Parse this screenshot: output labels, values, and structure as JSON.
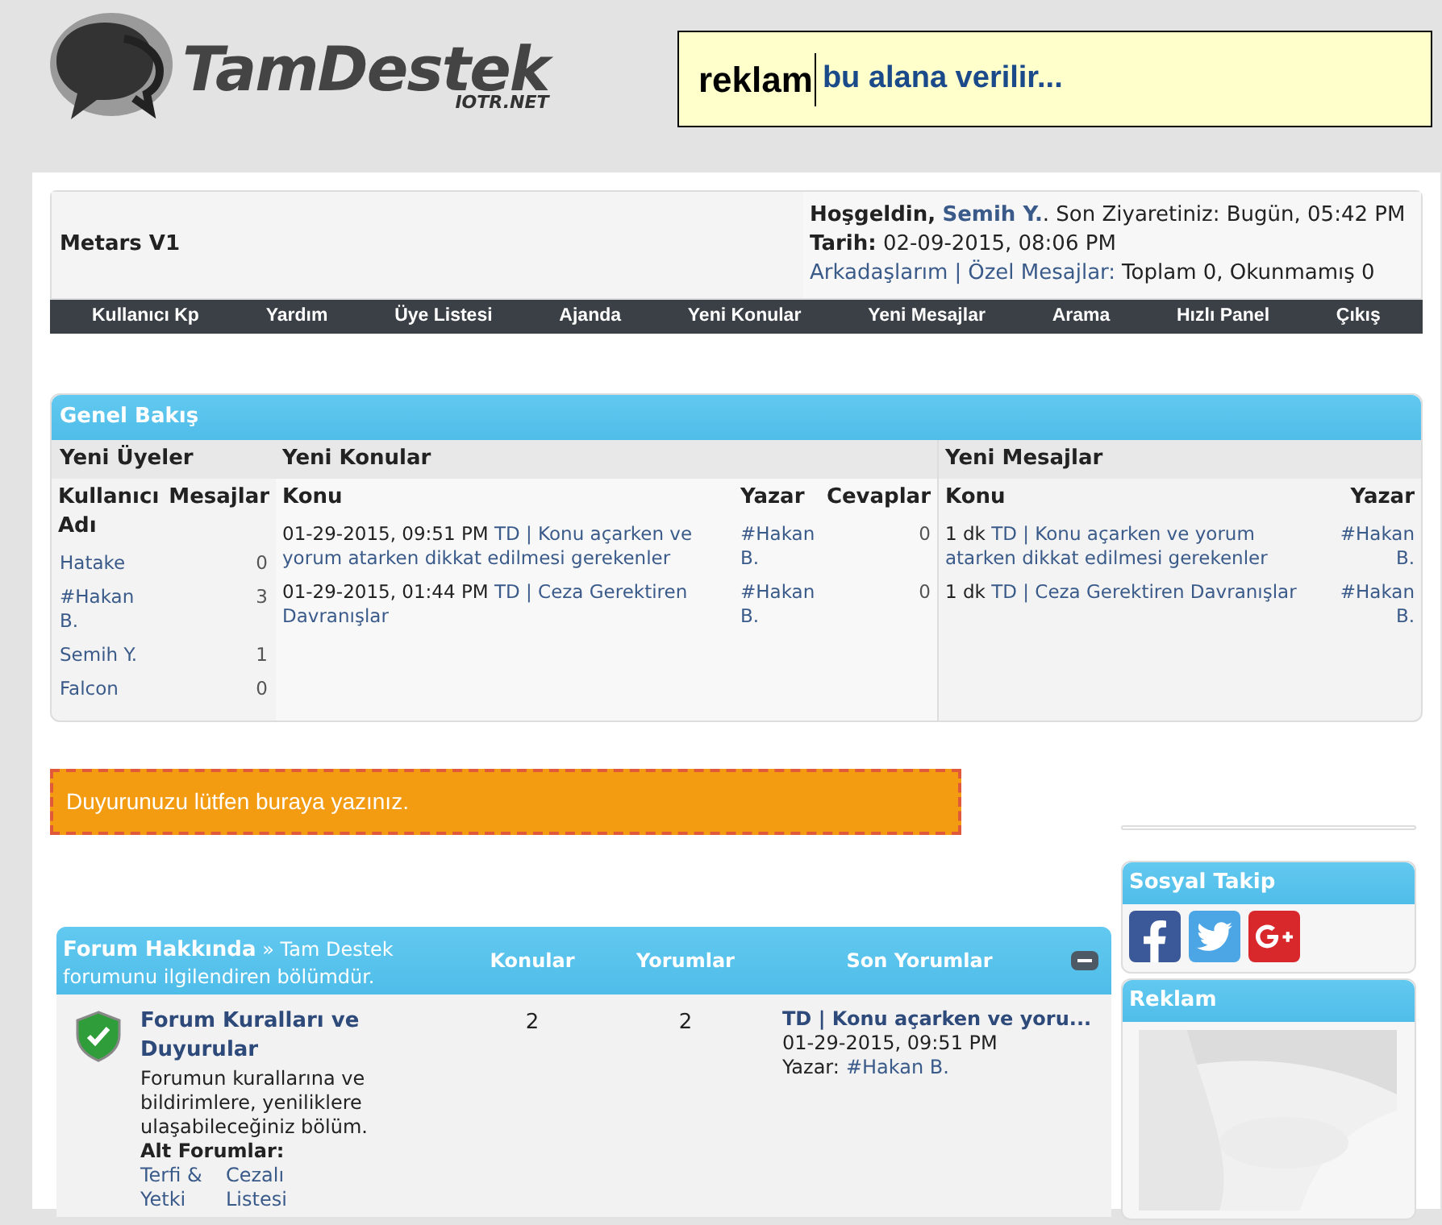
{
  "logo": {
    "name": "TamDestek",
    "domain": "IOTR.NET"
  },
  "ad_banner": {
    "bold": "reklam",
    "text": "bu alana verilir..."
  },
  "welcome": {
    "site_title": "Metars V1",
    "greeting": "Hoşgeldin,",
    "user": "Semih Y.",
    "last_visit": ". Son Ziyaretiniz: Bugün, 05:42 PM",
    "date_label": "Tarih:",
    "date": "02-09-2015, 08:06 PM",
    "friends_link": "Arkadaşlarım",
    "separator": "|",
    "messages_link": "Özel Mesajlar:",
    "messages_status": "Toplam 0, Okunmamış 0"
  },
  "navbar": [
    "Kullanıcı Kp",
    "Yardım",
    "Üye Listesi",
    "Ajanda",
    "Yeni Konular",
    "Yeni Mesajlar",
    "Arama",
    "Hızlı Panel",
    "Çıkış"
  ],
  "overview": {
    "title": "Genel Bakış",
    "new_members": {
      "title": "Yeni Üyeler",
      "columns": [
        "Kullanıcı Adı",
        "Mesajlar"
      ],
      "rows": [
        {
          "name": "Hatake",
          "posts": "0"
        },
        {
          "name": "#Hakan B.",
          "posts": "3"
        },
        {
          "name": "Semih Y.",
          "posts": "1"
        },
        {
          "name": "Falcon",
          "posts": "0"
        }
      ]
    },
    "new_topics": {
      "title": "Yeni Konular",
      "columns": [
        "Konu",
        "Yazar",
        "Cevaplar"
      ],
      "rows": [
        {
          "time": "01-29-2015, 09:51 PM",
          "topic": "TD | Konu açarken ve yorum atarken dikkat edilmesi gerekenler",
          "author": "#Hakan B.",
          "replies": "0"
        },
        {
          "time": "01-29-2015, 01:44 PM",
          "topic": "TD | Ceza Gerektiren Davranışlar",
          "author": "#Hakan B.",
          "replies": "0"
        }
      ]
    },
    "new_posts": {
      "title": "Yeni Mesajlar",
      "columns": [
        "Konu",
        "Yazar"
      ],
      "rows": [
        {
          "time": "1 dk",
          "topic": "TD | Konu açarken ve yorum atarken dikkat edilmesi gerekenler",
          "author": "#Hakan B."
        },
        {
          "time": "1 dk",
          "topic": "TD | Ceza Gerektiren Davranışlar",
          "author": "#Hakan B."
        }
      ]
    }
  },
  "announcement": "Duyurunuzu lütfen buraya yazınız.",
  "forum": {
    "category": "Forum Hakkında",
    "arrow": "»",
    "description": "Tam Destek forumunu ilgilendiren bölümdür.",
    "columns": [
      "Konular",
      "Yorumlar",
      "Son Yorumlar"
    ],
    "expanded": true,
    "rows": [
      {
        "title": "Forum Kuralları ve Duyurular",
        "description": "Forumun kurallarına ve bildirimlere, yeniliklere ulaşabileceğiniz bölüm.",
        "subforums_label": "Alt Forumlar:",
        "subforums": [
          "Terfi & Yetki",
          "Cezalı Listesi"
        ],
        "topics": "2",
        "posts": "2",
        "last_post": {
          "title": "TD | Konu açarken ve yoru...",
          "time": "01-29-2015, 09:51 PM",
          "author_label": "Yazar:",
          "author": "#Hakan B."
        }
      }
    ]
  },
  "sidebar": {
    "social_title": "Sosyal Takip",
    "ad_title": "Reklam"
  }
}
